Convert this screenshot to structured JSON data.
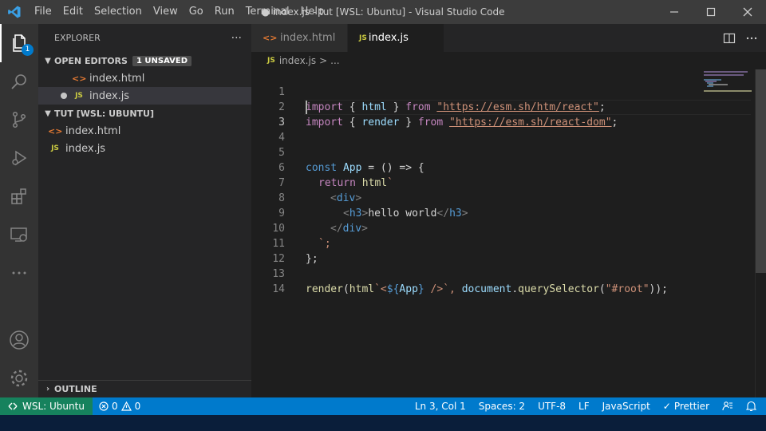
{
  "window": {
    "title": "● index.js - tut [WSL: Ubuntu] - Visual Studio Code",
    "app_icon": "vscode-logo-icon"
  },
  "menu": [
    "File",
    "Edit",
    "Selection",
    "View",
    "Go",
    "Run",
    "Terminal",
    "Help"
  ],
  "activity_bar": {
    "items": [
      "explorer-icon",
      "search-icon",
      "source-control-icon",
      "run-debug-icon",
      "extensions-icon",
      "remote-explorer-icon",
      "more-icon"
    ],
    "explorer_badge": "1",
    "bottom": [
      "account-icon",
      "settings-gear-icon"
    ]
  },
  "sidebar": {
    "title": "EXPLORER",
    "more": "···",
    "open_editors": {
      "label": "OPEN EDITORS",
      "badge": "1 UNSAVED",
      "files": [
        {
          "name": "index.html",
          "icon": "html-file-icon"
        },
        {
          "name": "index.js",
          "icon": "js-file-icon",
          "unsaved": true
        }
      ]
    },
    "folder": {
      "label": "TUT [WSL: UBUNTU]",
      "files": [
        {
          "name": "index.html",
          "icon_text": "<>"
        },
        {
          "name": "index.js",
          "icon_text": "JS"
        }
      ]
    },
    "outline_label": "OUTLINE"
  },
  "tabs": [
    {
      "label": "index.html",
      "icon_text": "<>",
      "active": false
    },
    {
      "label": "index.js",
      "icon_text": "JS",
      "active": true,
      "dirty": true
    }
  ],
  "breadcrumb": {
    "icon_text": "JS",
    "file": "index.js",
    "sep": ">",
    "rest": "..."
  },
  "editor": {
    "line_numbers": [
      "1",
      "2",
      "3",
      "4",
      "5",
      "6",
      "7",
      "8",
      "9",
      "10",
      "11",
      "12",
      "13",
      "14"
    ],
    "current_line": 3,
    "code": {
      "l1": {
        "kw": "import",
        "open": " { ",
        "var": "html",
        "close": " } ",
        "from": "from",
        "sp": " ",
        "str": "\"https://esm.sh/htm/react\"",
        "end": ";"
      },
      "l2": {
        "kw": "import",
        "open": " { ",
        "var": "render",
        "close": " } ",
        "from": "from",
        "sp": " ",
        "str": "\"https://esm.sh/react-dom\"",
        "end": ";"
      },
      "l5": {
        "kw": "const",
        "sp": " ",
        "var": "App",
        "rest": " = () => {"
      },
      "l6": {
        "kw": "return",
        "sp": " ",
        "fn": "html",
        "tick": "`"
      },
      "l7": {
        "open": "<",
        "tag": "div",
        "close": ">"
      },
      "l8": {
        "open": "<",
        "tag": "h3",
        "close": ">",
        "text": "hello world",
        "eopen": "</",
        "etag": "h3",
        "eclose": ">"
      },
      "l9": {
        "open": "</",
        "tag": "div",
        "close": ">"
      },
      "l10": {
        "text": "`;"
      },
      "l11": {
        "text": "};"
      },
      "l13": {
        "fn": "render",
        "p1": "(",
        "fn2": "html",
        "tick": "`<",
        "tpl": "${",
        "var": "App",
        "tplc": "}",
        "rest": " />`, ",
        "var2": "document",
        "dot": ".",
        "fn3": "querySelector",
        "p2": "(",
        "str": "\"#root\"",
        "p3": "));"
      }
    }
  },
  "statusbar": {
    "remote": "WSL: Ubuntu",
    "errors": "0",
    "warnings": "0",
    "position": "Ln 3, Col 1",
    "spaces": "Spaces: 2",
    "encoding": "UTF-8",
    "eol": "LF",
    "language": "JavaScript",
    "formatter": "Prettier"
  },
  "colors": {
    "accent": "#007acc",
    "remote": "#16825d"
  }
}
